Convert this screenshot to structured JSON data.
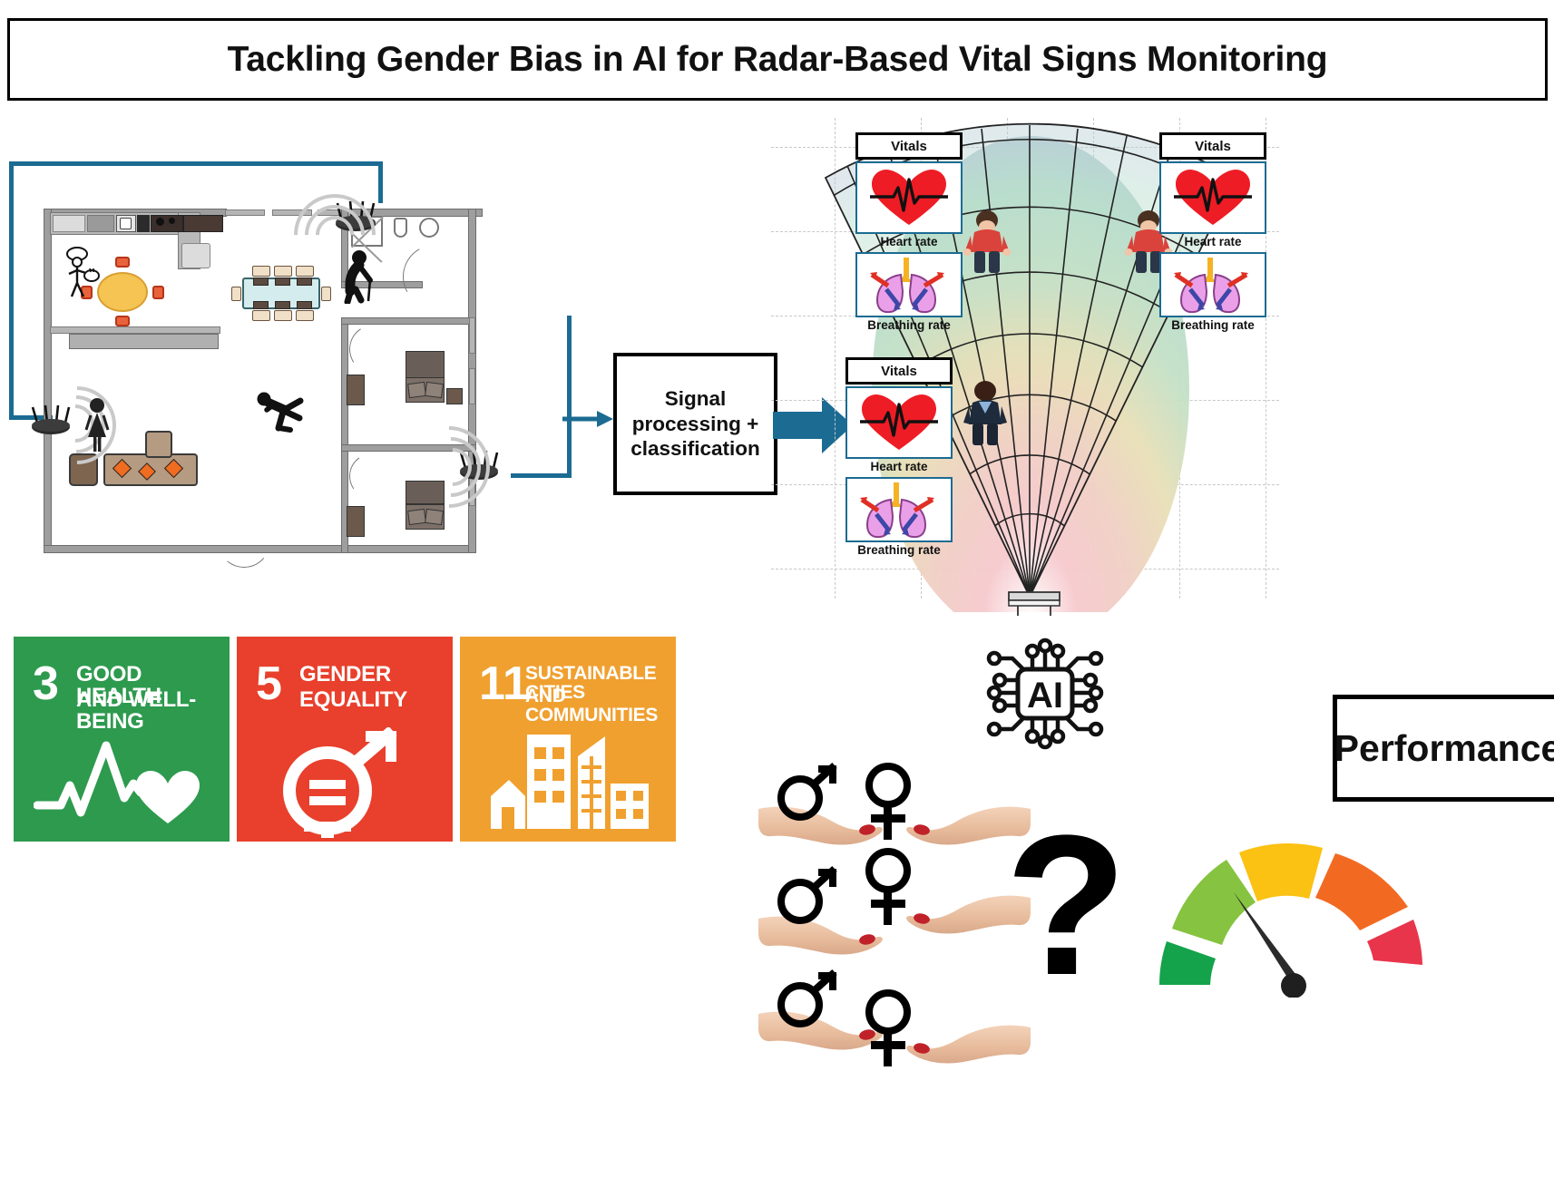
{
  "title": {
    "text": "Tackling Gender Bias in AI for Radar-Based Vital Signs Monitoring"
  },
  "pipeline": {
    "signal_box_line1": "Signal",
    "signal_box_line2": "processing +",
    "signal_box_line3": "classification",
    "arrow_color": "#1b6b92",
    "input_arrow_name": "floorplan-to-processing-arrow",
    "output_arrow_name": "processing-to-radar-arrow"
  },
  "floorplan": {
    "name": "smart-home-floor-plan",
    "routers": [
      {
        "id": "router-kitchen-top",
        "label": "radar-sensor"
      },
      {
        "id": "router-living-left",
        "label": "radar-sensor"
      },
      {
        "id": "router-bedroom-right",
        "label": "radar-sensor"
      }
    ],
    "occupants": [
      {
        "id": "person-cooking",
        "label": "cooking-stick-figure"
      },
      {
        "id": "person-elderly-cane",
        "label": "elderly-person-with-cane"
      },
      {
        "id": "person-standing-woman",
        "label": "standing-woman"
      },
      {
        "id": "person-falling",
        "label": "falling-person"
      }
    ],
    "rooms": [
      "kitchen",
      "dining",
      "living room",
      "bathroom",
      "bedroom 1",
      "bedroom 2"
    ]
  },
  "radar": {
    "beam_name": "radar-fan-beam",
    "panels": [
      {
        "id": "vitals-panel-left",
        "header": "Vitals",
        "heart_caption": "Heart rate",
        "breath_caption": "Breathing rate"
      },
      {
        "id": "vitals-panel-right",
        "header": "Vitals",
        "heart_caption": "Heart rate",
        "breath_caption": "Breathing rate"
      },
      {
        "id": "vitals-panel-bottom",
        "header": "Vitals",
        "heart_caption": "Heart rate",
        "breath_caption": "Breathing rate"
      }
    ],
    "subjects": [
      {
        "id": "subject-1",
        "shirt": "#d9433c"
      },
      {
        "id": "subject-2",
        "shirt": "#d9433c"
      },
      {
        "id": "subject-3",
        "shirt": "#1d2b3c"
      }
    ],
    "beam_colors": [
      "#b9bede",
      "#b7dccb",
      "#e7d9b0",
      "#f3c3c6"
    ]
  },
  "ai_chip": {
    "label": "AI",
    "name": "ai-chip-icon"
  },
  "question_mark": {
    "text": "?"
  },
  "sdg": [
    {
      "number": "3",
      "line1": "GOOD HEALTH",
      "line2": "AND WELL-BEING",
      "color": "#2d9a4e",
      "icon": "heartbeat-heart-icon"
    },
    {
      "number": "5",
      "line1": "GENDER",
      "line2": "EQUALITY",
      "color": "#e8402c",
      "icon": "gender-equality-icon"
    },
    {
      "number": "11",
      "line1": "SUSTAINABLE CITIES",
      "line2": "AND COMMUNITIES",
      "color": "#f0a02f",
      "icon": "city-buildings-icon"
    }
  ],
  "gender_balance": {
    "name": "gender-balance-hands",
    "rows": [
      {
        "male": "♂",
        "female": "♀",
        "offset": "level"
      },
      {
        "male": "♂",
        "female": "♀",
        "offset": "female-higher"
      },
      {
        "male": "♂",
        "female": "♀",
        "offset": "female-lower"
      }
    ]
  },
  "performance": {
    "label": "Performance",
    "gauge_name": "performance-gauge",
    "segments": [
      {
        "name": "dark-green",
        "color": "#14a34a"
      },
      {
        "name": "light-green",
        "color": "#86c341"
      },
      {
        "name": "yellow",
        "color": "#fbc113"
      },
      {
        "name": "orange",
        "color": "#f26a22"
      },
      {
        "name": "red",
        "color": "#e8354c"
      }
    ],
    "needle_name": "gauge-needle",
    "needle_position": "light-green"
  }
}
